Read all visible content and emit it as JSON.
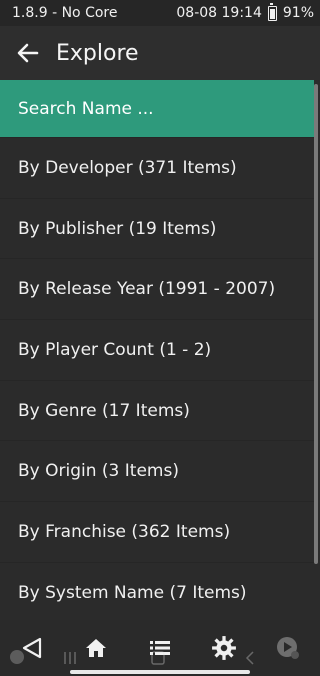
{
  "status": {
    "left": "1.8.9 - No Core",
    "time": "08-08 19:14",
    "battery": "91%"
  },
  "appbar": {
    "title": "Explore"
  },
  "list": {
    "items": [
      "Search Name ...",
      "By Developer (371 Items)",
      "By Publisher (19 Items)",
      "By Release Year (1991 - 2007)",
      "By Player Count (1 - 2)",
      "By Genre (17 Items)",
      "By Origin (3 Items)",
      "By Franchise (362 Items)",
      "By System Name (7 Items)"
    ]
  },
  "navbar": {
    "icons": [
      "back-triangle-icon",
      "home-icon",
      "list-icon",
      "gear-icon",
      "play-icon"
    ]
  }
}
